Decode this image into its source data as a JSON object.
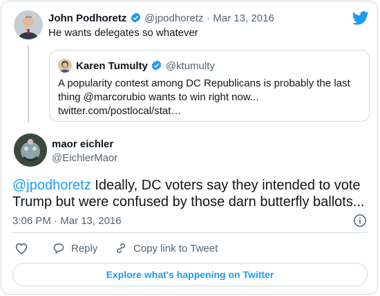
{
  "colors": {
    "accent": "#1d9bf0",
    "muted": "#536471",
    "border": "#cfd9de"
  },
  "parent_tweet": {
    "author_name": "John Podhoretz",
    "handle": "@jpodhoretz",
    "separator": "·",
    "date": "Mar 13, 2016",
    "text": "He wants delegates so whatever",
    "verified_icon": "verified-badge-icon"
  },
  "quoted_tweet": {
    "author_name": "Karen Tumulty",
    "handle": "@ktumulty",
    "text": "A popularity contest among DC Republicans is probably the last thing @marcorubio wants to win right now...",
    "link": "twitter.com/postlocal/stat…",
    "verified_icon": "verified-badge-icon"
  },
  "main_tweet": {
    "author_name": "maor eichler",
    "handle": "@EichlerMaor",
    "mention": "@jpodhoretz",
    "text": " Ideally, DC voters say they intended to vote Trump but were confused by those darn butterfly ballots...",
    "time": "3:06 PM",
    "separator": "·",
    "date": "Mar 13, 2016"
  },
  "actions": {
    "like_icon": "heart-icon",
    "reply_label": "Reply",
    "copy_link_label": "Copy link to Tweet"
  },
  "explore_label": "Explore what's happening on Twitter",
  "icons": [
    "twitter-bird-icon",
    "info-icon",
    "heart-icon",
    "reply-icon",
    "link-icon"
  ]
}
